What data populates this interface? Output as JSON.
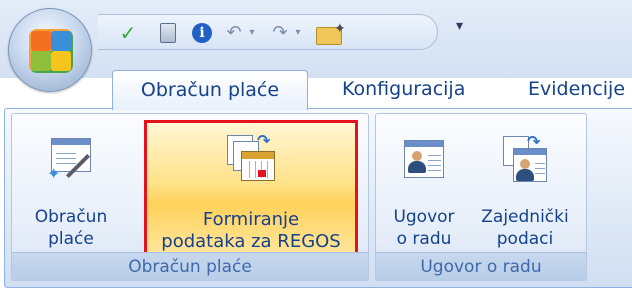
{
  "window": {
    "office_button_icon": "office-logo-icon",
    "quick_access": {
      "items": [
        "check-icon",
        "calculator-icon",
        "info-icon",
        "undo-icon",
        "undo-dropdown-icon",
        "redo-icon",
        "redo-dropdown-icon",
        "open-folder-icon"
      ],
      "customize_icon": "customize-dropdown-icon"
    }
  },
  "ribbon": {
    "tabs": [
      {
        "label": "Obračun plaće",
        "active": true
      },
      {
        "label": "Konfiguracija",
        "active": false
      },
      {
        "label": "Evidencije",
        "active": false
      }
    ],
    "groups": [
      {
        "label": "Obračun plaće",
        "buttons": [
          {
            "label_line1": "Obračun",
            "label_line2": "plaće",
            "icon": "payroll-wizard-icon",
            "highlighted": false
          },
          {
            "label_line1": "Formiranje",
            "label_line2": "podataka za REGOS",
            "icon": "calendar-export-icon",
            "highlighted": true
          }
        ]
      },
      {
        "label": "Ugovor o radu",
        "buttons": [
          {
            "label_line1": "Ugovor",
            "label_line2": "o radu",
            "icon": "contact-card-icon",
            "highlighted": false
          },
          {
            "label_line1": "Zajednički",
            "label_line2": "podaci",
            "icon": "shared-contact-icon",
            "highlighted": false
          }
        ]
      }
    ],
    "highlight_color": "#e4121c"
  }
}
